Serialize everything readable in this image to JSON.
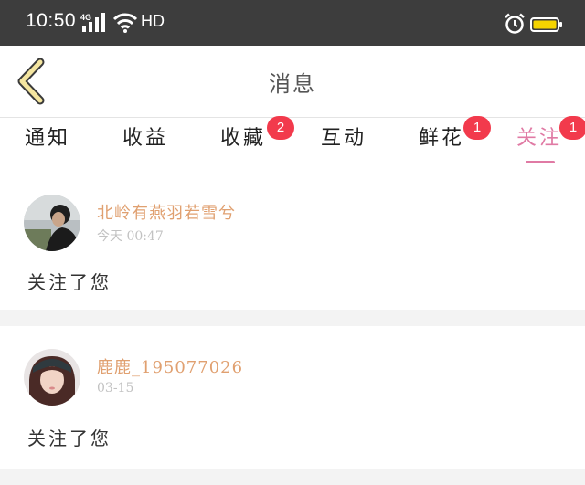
{
  "status_bar": {
    "time": "10:50",
    "network": "4G",
    "hd": "HD"
  },
  "header": {
    "title": "消息"
  },
  "tabs": [
    {
      "label": "通知",
      "badge": ""
    },
    {
      "label": "收益",
      "badge": ""
    },
    {
      "label": "收藏",
      "badge": "2"
    },
    {
      "label": "互动",
      "badge": ""
    },
    {
      "label": "鲜花",
      "badge": "1"
    },
    {
      "label": "关注",
      "badge": "1",
      "active": true
    }
  ],
  "notifications": [
    {
      "username": "北岭有燕羽若雪兮",
      "time": "今天 00:47",
      "message": "关注了您"
    },
    {
      "username": "鹿鹿_195077026",
      "time": "03-15",
      "message": "关注了您"
    }
  ],
  "colors": {
    "accent": "#e07aa4",
    "badge": "#f23a4c",
    "username": "#e0a070",
    "back_arrow": "#f5e6a0"
  }
}
